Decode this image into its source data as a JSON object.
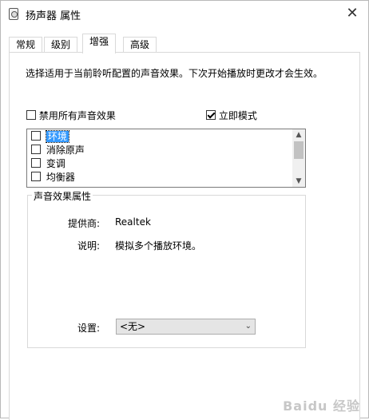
{
  "window": {
    "title": "扬声器 属性",
    "close_glyph": "✕"
  },
  "tabs": [
    {
      "label": "常规"
    },
    {
      "label": "级别"
    },
    {
      "label": "增强",
      "active": true
    },
    {
      "label": "高级"
    }
  ],
  "enhancements": {
    "description": "选择适用于当前聆听配置的声音效果。下次开始播放时更改才会生效。",
    "disable_all": {
      "label": "禁用所有声音效果",
      "checked": false
    },
    "immediate_mode": {
      "label": "立即模式",
      "checked": true
    },
    "effects": [
      {
        "label": "环境",
        "checked": false,
        "selected": true
      },
      {
        "label": "消除原声",
        "checked": false
      },
      {
        "label": "变调",
        "checked": false
      },
      {
        "label": "均衡器",
        "checked": false
      }
    ]
  },
  "properties": {
    "group_title": "声音效果属性",
    "provider_label": "提供商:",
    "provider_value": "Realtek",
    "description_label": "说明:",
    "description_value": "模拟多个播放环境。",
    "settings_label": "设置:",
    "settings_value": "<无>"
  },
  "watermark": "Baidu 经验",
  "colors": {
    "selection": "#3399ff",
    "border": "#d9d9d9"
  }
}
